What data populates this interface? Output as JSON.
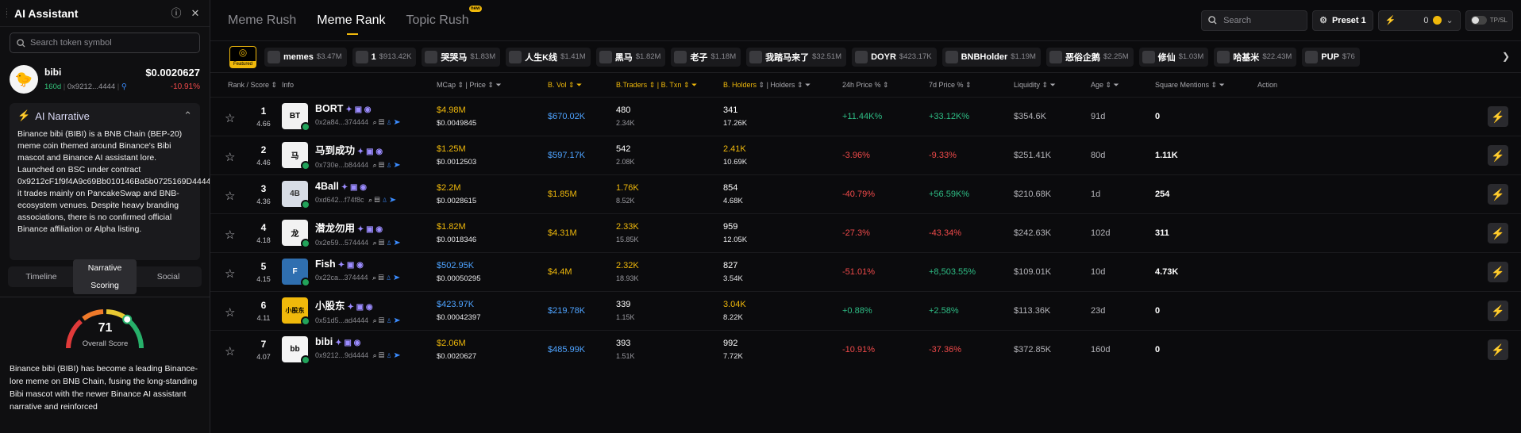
{
  "assistant": {
    "title": "AI Assistant",
    "search_placeholder": "Search token symbol",
    "token": {
      "name": "bibi",
      "age": "160d",
      "address": "0x9212...4444",
      "price": "$0.0020627",
      "change": "-10.91%"
    },
    "narrative": {
      "heading": "AI Narrative",
      "text": "Binance bibi (BIBI) is a BNB Chain (BEP-20) meme coin themed around Binance's Bibi mascot and Binance AI assistant lore. Launched on BSC under contract 0x9212cF1f9f4A9c69Bb010146Ba5b0725169D4444, it trades mainly on PancakeSwap and BNB-ecosystem venues. Despite heavy branding associations, there is no confirmed official Binance affiliation or Alpha listing."
    },
    "tabs": [
      "Timeline",
      "Narrative Scoring",
      "Social"
    ],
    "score": {
      "value": 71,
      "fraction": 0.71,
      "label": "Overall Score"
    },
    "summary": "Binance bibi (BIBI) has become a leading Binance-lore meme on BNB Chain, fusing the long-standing Bibi mascot with the newer Binance AI assistant narrative and reinforced"
  },
  "nav": {
    "tabs": [
      "Meme Rush",
      "Meme Rank",
      "Topic Rush"
    ],
    "new_badge": "new",
    "search_placeholder": "Search",
    "preset": "Preset 1",
    "quick_amount": "0",
    "tpsl": "TP/SL"
  },
  "featured_label": "Featured",
  "ticker": [
    {
      "name": "memes",
      "mcap": "$3.47M"
    },
    {
      "name": "1",
      "mcap": "$913.42K"
    },
    {
      "name": "哭哭马",
      "mcap": "$1.83M"
    },
    {
      "name": "人生K线",
      "mcap": "$1.41M"
    },
    {
      "name": "黑马",
      "mcap": "$1.82M"
    },
    {
      "name": "老子",
      "mcap": "$1.18M"
    },
    {
      "name": "我踏马来了",
      "mcap": "$32.51M"
    },
    {
      "name": "DOYR",
      "mcap": "$423.17K"
    },
    {
      "name": "BNBHolder",
      "mcap": "$1.19M"
    },
    {
      "name": "恶俗企鹅",
      "mcap": "$2.25M"
    },
    {
      "name": "修仙",
      "mcap": "$1.03M"
    },
    {
      "name": "哈基米",
      "mcap": "$22.43M"
    },
    {
      "name": "PUP",
      "mcap": "$76"
    }
  ],
  "headers": {
    "rank": "Rank / Score",
    "info": "Info",
    "mcap": "MCap",
    "price": "Price",
    "bvol": "B. Vol",
    "btraders": "B.Traders",
    "btxn": "B. Txn",
    "bholders": "B. Holders",
    "holders": "Holders",
    "p24": "24h Price %",
    "p7": "7d Price %",
    "liq": "Liquidity",
    "age": "Age",
    "mentions": "Square Mentions",
    "action": "Action"
  },
  "rows": [
    {
      "rank": "1",
      "score": "4.66",
      "name": "BORT",
      "addr": "0x2a84...374444",
      "mcap": "$4.98M",
      "price": "$0.0049845",
      "bvol": "$670.02K",
      "btraders": "480",
      "btxn": "2.34K",
      "bholders": "341",
      "holders": "17.26K",
      "p24": "+11.44K%",
      "p7": "+33.12K%",
      "liq": "$354.6K",
      "age": "91d",
      "mentions": "0",
      "mcap_color": "ylw",
      "traders_color": "white",
      "bh_color": "white",
      "p24_color": "green",
      "p7_color": "green",
      "av": "BT"
    },
    {
      "rank": "2",
      "score": "4.46",
      "name": "马到成功",
      "addr": "0x730e...b84444",
      "mcap": "$1.25M",
      "price": "$0.0012503",
      "bvol": "$597.17K",
      "btraders": "542",
      "btxn": "2.08K",
      "bholders": "2.41K",
      "holders": "10.69K",
      "p24": "-3.96%",
      "p7": "-9.33%",
      "liq": "$251.41K",
      "age": "80d",
      "mentions": "1.11K",
      "mcap_color": "ylw",
      "traders_color": "white",
      "bh_color": "ylw",
      "p24_color": "redc",
      "p7_color": "redc",
      "av": "马"
    },
    {
      "rank": "3",
      "score": "4.36",
      "name": "4Ball",
      "addr": "0xd642...f74f8c",
      "mcap": "$2.2M",
      "price": "$0.0028615",
      "bvol": "$1.85M",
      "btraders": "1.76K",
      "btxn": "8.52K",
      "bholders": "854",
      "holders": "4.68K",
      "p24": "-40.79%",
      "p7": "+56.59K%",
      "liq": "$210.68K",
      "age": "1d",
      "mentions": "254",
      "mcap_color": "ylw",
      "traders_color": "ylw",
      "bh_color": "white",
      "p24_color": "redc",
      "p7_color": "green",
      "av": "4B"
    },
    {
      "rank": "4",
      "score": "4.18",
      "name": "潜龙勿用",
      "addr": "0x2e59...574444",
      "mcap": "$1.82M",
      "price": "$0.0018346",
      "bvol": "$4.31M",
      "btraders": "2.33K",
      "btxn": "15.85K",
      "bholders": "959",
      "holders": "12.05K",
      "p24": "-27.3%",
      "p7": "-43.34%",
      "liq": "$242.63K",
      "age": "102d",
      "mentions": "311",
      "mcap_color": "ylw",
      "traders_color": "ylw",
      "bh_color": "white",
      "p24_color": "redc",
      "p7_color": "redc",
      "av": "龙"
    },
    {
      "rank": "5",
      "score": "4.15",
      "name": "Fish",
      "addr": "0x22ca...374444",
      "mcap": "$502.95K",
      "price": "$0.00050295",
      "bvol": "$4.4M",
      "btraders": "2.32K",
      "btxn": "18.93K",
      "bholders": "827",
      "holders": "3.54K",
      "p24": "-51.01%",
      "p7": "+8,503.55%",
      "liq": "$109.01K",
      "age": "10d",
      "mentions": "4.73K",
      "mcap_color": "blue",
      "traders_color": "ylw",
      "bh_color": "white",
      "p24_color": "redc",
      "p7_color": "green",
      "av": "F"
    },
    {
      "rank": "6",
      "score": "4.11",
      "name": "小股东",
      "addr": "0x51d5...ad4444",
      "mcap": "$423.97K",
      "price": "$0.00042397",
      "bvol": "$219.78K",
      "btraders": "339",
      "btxn": "1.15K",
      "bholders": "3.04K",
      "holders": "8.22K",
      "p24": "+0.88%",
      "p7": "+2.58%",
      "liq": "$113.36K",
      "age": "23d",
      "mentions": "0",
      "mcap_color": "blue",
      "traders_color": "white",
      "bh_color": "ylw",
      "p24_color": "green",
      "p7_color": "green",
      "av": "小股东"
    },
    {
      "rank": "7",
      "score": "4.07",
      "name": "bibi",
      "addr": "0x9212...9d4444",
      "mcap": "$2.06M",
      "price": "$0.0020627",
      "bvol": "$485.99K",
      "btraders": "393",
      "btxn": "1.51K",
      "bholders": "992",
      "holders": "7.72K",
      "p24": "-10.91%",
      "p7": "-37.36%",
      "liq": "$372.85K",
      "age": "160d",
      "mentions": "0",
      "mcap_color": "ylw",
      "traders_color": "white",
      "bh_color": "white",
      "p24_color": "redc",
      "p7_color": "redc",
      "av": "bb"
    }
  ],
  "icons": [
    "info-icon",
    "close-icon",
    "search-icon",
    "star-icon",
    "bolt-icon",
    "sliders-icon",
    "chevron-right-icon"
  ]
}
